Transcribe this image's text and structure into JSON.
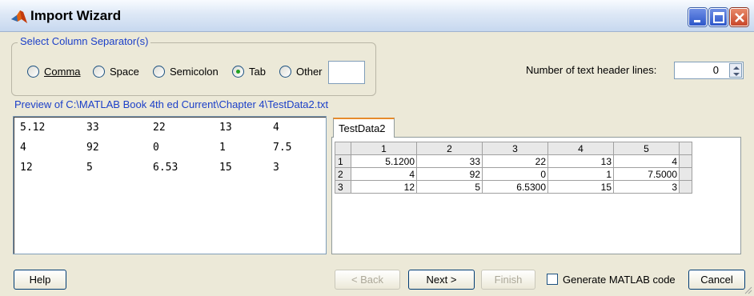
{
  "window": {
    "title": "Import Wizard"
  },
  "separator": {
    "legend": "Select Column Separator(s)",
    "options": [
      {
        "label": "Comma",
        "selected": false
      },
      {
        "label": "Space",
        "selected": false
      },
      {
        "label": "Semicolon",
        "selected": false
      },
      {
        "label": "Tab",
        "selected": true
      },
      {
        "label": "Other",
        "selected": false
      }
    ],
    "other_value": ""
  },
  "header_lines": {
    "label": "Number of text header lines:",
    "value": "0"
  },
  "preview": {
    "label": "Preview of C:\\MATLAB Book 4th ed Current\\Chapter 4\\TestData2.txt",
    "rows": [
      [
        "5.12",
        "33",
        "22",
        "13",
        "4"
      ],
      [
        "4",
        "92",
        "0",
        "1",
        "7.5"
      ],
      [
        "12",
        "5",
        "6.53",
        "15",
        "3"
      ]
    ]
  },
  "data_tab": {
    "name": "TestData2"
  },
  "table": {
    "columns": [
      "1",
      "2",
      "3",
      "4",
      "5"
    ],
    "rows": [
      {
        "label": "1",
        "cells": [
          "5.1200",
          "33",
          "22",
          "13",
          "4"
        ]
      },
      {
        "label": "2",
        "cells": [
          "4",
          "92",
          "0",
          "1",
          "7.5000"
        ]
      },
      {
        "label": "3",
        "cells": [
          "12",
          "5",
          "6.5300",
          "15",
          "3"
        ]
      }
    ]
  },
  "buttons": {
    "help": "Help",
    "back": "< Back",
    "next": "Next >",
    "finish": "Finish",
    "cancel": "Cancel"
  },
  "generate_code": {
    "label": "Generate MATLAB code",
    "checked": false
  }
}
